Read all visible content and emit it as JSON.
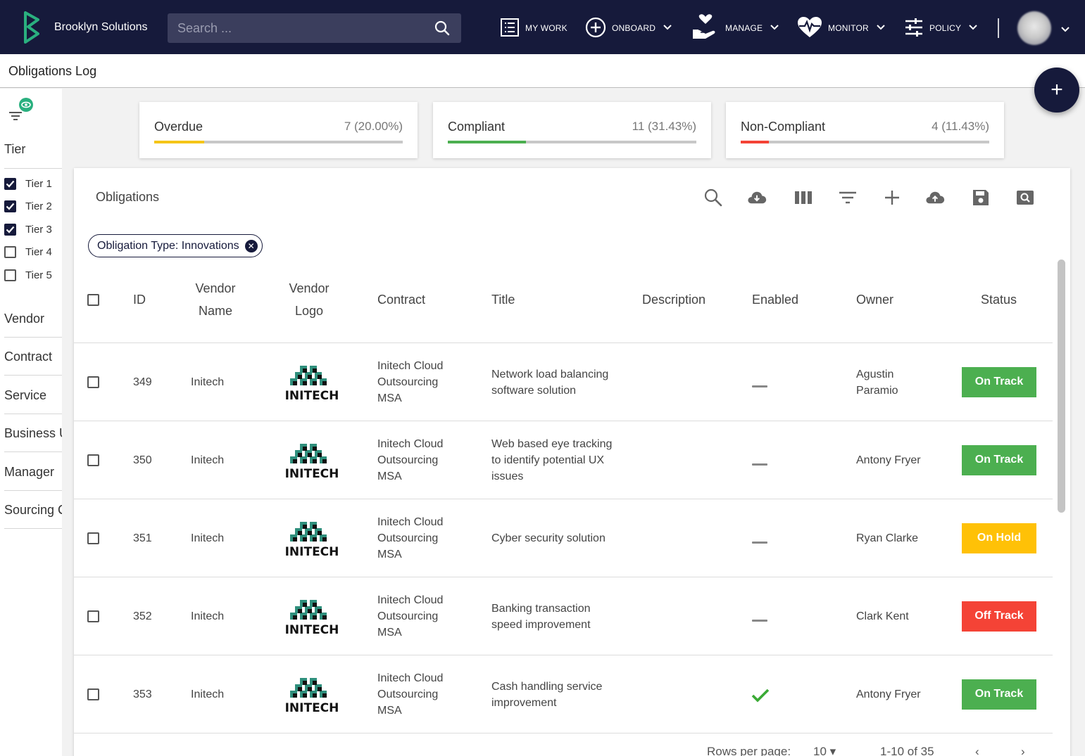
{
  "app": {
    "brand": "Brooklyn Solutions",
    "search_placeholder": "Search ...",
    "nav": {
      "my_work": "MY WORK",
      "onboard": "ONBOARD",
      "manage": "MANAGE",
      "monitor": "MONITOR",
      "policy": "POLICY"
    },
    "colors": {
      "topbar": "#161a3b",
      "accent": "#2ab07f"
    }
  },
  "page": {
    "title": "Obligations Log",
    "add_button": "+"
  },
  "sidebar": {
    "tier_heading": "Tier",
    "tiers": [
      {
        "label": "Tier 1",
        "checked": true
      },
      {
        "label": "Tier 2",
        "checked": true
      },
      {
        "label": "Tier 3",
        "checked": true
      },
      {
        "label": "Tier 4",
        "checked": false
      },
      {
        "label": "Tier 5",
        "checked": false
      }
    ],
    "sections": [
      "Vendor",
      "Contract",
      "Service",
      "Business Unit",
      "Manager",
      "Sourcing Category"
    ]
  },
  "summary": [
    {
      "label": "Overdue",
      "value": "7 (20.00%)",
      "fraction": 0.2,
      "color": "#f5c518"
    },
    {
      "label": "Compliant",
      "value": "11 (31.43%)",
      "fraction": 0.3143,
      "color": "#4caf50"
    },
    {
      "label": "Non-Compliant",
      "value": "4 (11.43%)",
      "fraction": 0.1143,
      "color": "#f44336"
    }
  ],
  "table": {
    "title": "Obligations",
    "toolbar_icons": [
      "search-icon",
      "download-icon",
      "columns-icon",
      "filter-icon",
      "add-icon",
      "upload-icon",
      "save-icon",
      "saved-search-icon"
    ],
    "filter_chip": "Obligation Type: Innovations",
    "columns": {
      "id": "ID",
      "vendor_name_1": "Vendor",
      "vendor_name_2": "Name",
      "vendor_logo_1": "Vendor",
      "vendor_logo_2": "Logo",
      "contract": "Contract",
      "title": "Title",
      "description": "Description",
      "enabled": "Enabled",
      "owner": "Owner",
      "status": "Status"
    },
    "rows": [
      {
        "id": "349",
        "vendor": "Initech",
        "logo_text": "INITECH",
        "contract": [
          "Initech Cloud",
          "Outsourcing",
          "MSA"
        ],
        "title": [
          "Network load balancing",
          "software solution"
        ],
        "description": "",
        "enabled": false,
        "owner": [
          "Agustin",
          "Paramio"
        ],
        "status": "On Track",
        "status_color": "#4caf50"
      },
      {
        "id": "350",
        "vendor": "Initech",
        "logo_text": "INITECH",
        "contract": [
          "Initech Cloud",
          "Outsourcing",
          "MSA"
        ],
        "title": [
          "Web based eye tracking",
          "to identify potential UX",
          "issues"
        ],
        "description": "",
        "enabled": false,
        "owner": [
          "Antony Fryer"
        ],
        "status": "On Track",
        "status_color": "#4caf50"
      },
      {
        "id": "351",
        "vendor": "Initech",
        "logo_text": "INITECH",
        "contract": [
          "Initech Cloud",
          "Outsourcing",
          "MSA"
        ],
        "title": [
          "Cyber security solution"
        ],
        "description": "",
        "enabled": false,
        "owner": [
          "Ryan Clarke"
        ],
        "status": "On Hold",
        "status_color": "#ffc107"
      },
      {
        "id": "352",
        "vendor": "Initech",
        "logo_text": "INITECH",
        "contract": [
          "Initech Cloud",
          "Outsourcing",
          "MSA"
        ],
        "title": [
          "Banking transaction",
          "speed improvement"
        ],
        "description": "",
        "enabled": false,
        "owner": [
          "Clark Kent"
        ],
        "status": "Off Track",
        "status_color": "#f44336"
      },
      {
        "id": "353",
        "vendor": "Initech",
        "logo_text": "INITECH",
        "contract": [
          "Initech Cloud",
          "Outsourcing",
          "MSA"
        ],
        "title": [
          "Cash handling service",
          "improvement"
        ],
        "description": "",
        "enabled": true,
        "owner": [
          "Antony Fryer"
        ],
        "status": "On Track",
        "status_color": "#4caf50"
      }
    ],
    "pagination": {
      "rows_per_page_label": "Rows per page:",
      "rows_per_page": "10",
      "range": "1-10 of 35"
    }
  }
}
